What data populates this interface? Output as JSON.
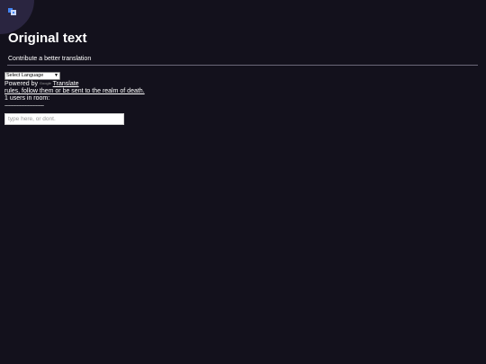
{
  "translate_popup": {
    "title": "Original text",
    "contribute_link": "Contribute a better translation"
  },
  "translate_widget": {
    "language_select_value": "Select Language",
    "powered_by": "Powered by ",
    "google_logo_text": "Google",
    "translate_link": "Translate"
  },
  "chat": {
    "rules_link": "rules, follow them or be sent to the realm of death.",
    "user_count": "1 users in room:",
    "separator": "-----------------------------",
    "input_placeholder": "type here, or dont."
  },
  "colors": {
    "background": "#13111c",
    "text": "#ffffff",
    "divider": "#6b6878"
  },
  "icons": {
    "translate": "translate-icon"
  }
}
